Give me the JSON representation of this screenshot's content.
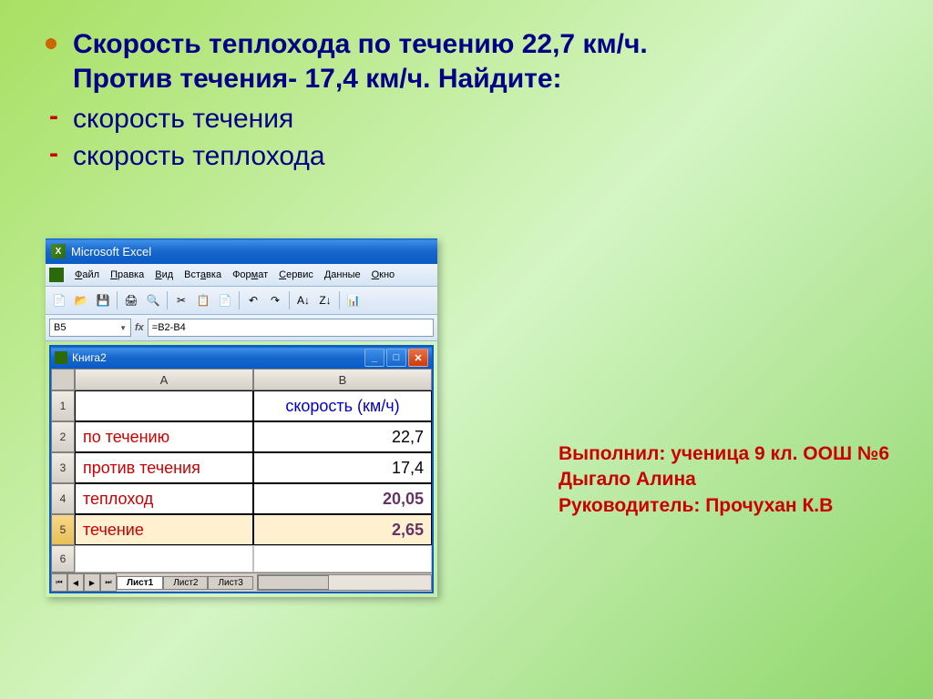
{
  "slide": {
    "title_line1": "Скорость теплохода по течению 22,7 км/ч.",
    "title_line2": "Против течения- 17,4 км/ч. Найдите:",
    "sub1": "скорость течения",
    "sub2": "скорость теплохода"
  },
  "excel": {
    "app_title": "Microsoft Excel",
    "menu": {
      "file": "Файл",
      "edit": "Правка",
      "view": "Вид",
      "insert": "Вставка",
      "format": "Формат",
      "tools": "Сервис",
      "data": "Данные",
      "window": "Окно"
    },
    "namebox": "B5",
    "fx": "fx",
    "formula": "=B2-B4",
    "workbook_title": "Книга2",
    "columns": [
      "A",
      "B"
    ],
    "rows": [
      {
        "n": "1",
        "a": "",
        "b": "скорость (км/ч)",
        "b_class": "header-cell"
      },
      {
        "n": "2",
        "a": "по течению",
        "b": "22,7",
        "b_class": "cell-b"
      },
      {
        "n": "3",
        "a": "против течения",
        "b": "17,4",
        "b_class": "cell-b"
      },
      {
        "n": "4",
        "a": "теплоход",
        "b": "20,05",
        "b_class": "result-cell"
      },
      {
        "n": "5",
        "a": "течение",
        "b": "2,65",
        "b_class": "result-cell"
      },
      {
        "n": "6",
        "a": "",
        "b": "",
        "b_class": ""
      }
    ],
    "tabs": {
      "t1": "Лист1",
      "t2": "Лист2",
      "t3": "Лист3"
    }
  },
  "attribution": {
    "l1": "Выполнил: ученица 9 кл. ООШ №6",
    "l2": "Дыгало Алина",
    "l3": "Руководитель: Прочухан К.В"
  },
  "chart_data": {
    "type": "table",
    "title": "скорость (км/ч)",
    "categories": [
      "по течению",
      "против течения",
      "теплоход",
      "течение"
    ],
    "values": [
      22.7,
      17.4,
      20.05,
      2.65
    ]
  }
}
